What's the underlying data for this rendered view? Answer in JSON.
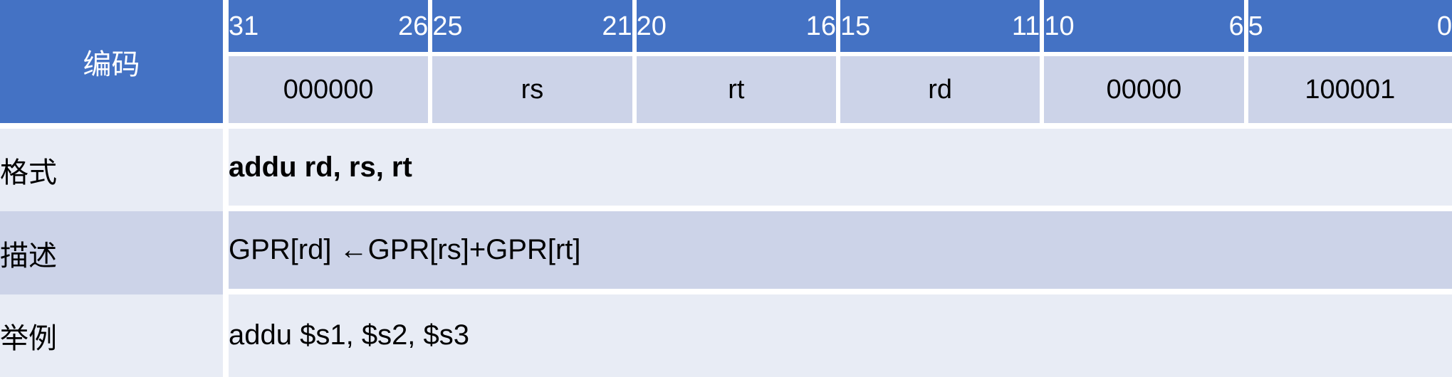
{
  "table": {
    "encoding_label": "编码",
    "bit_header": [
      {
        "high": "31",
        "low": "26"
      },
      {
        "high": "25",
        "low": "21"
      },
      {
        "high": "20",
        "low": "16"
      },
      {
        "high": "15",
        "low": "11"
      },
      {
        "high": "10",
        "low": "6"
      },
      {
        "high": "5",
        "low": "0"
      }
    ],
    "field_values": [
      "000000",
      "rs",
      "rt",
      "rd",
      "00000",
      "100001"
    ],
    "rows": [
      {
        "label": "格式",
        "value": "addu rd, rs, rt",
        "bold": true
      },
      {
        "label": "描述",
        "value": "GPR[rd] ←GPR[rs]+GPR[rt]",
        "bold": false
      },
      {
        "label": "举例",
        "value": "addu $s1, $s2, $s3",
        "bold": false
      }
    ]
  },
  "colors": {
    "header_blue": "#4472c4",
    "field_row_bg": "#ccd3e8",
    "row_light_bg": "#e8ecf5",
    "row_dark_bg": "#ccd3e8",
    "grid_white": "#ffffff",
    "text_dark": "#000000",
    "text_light": "#ffffff"
  }
}
